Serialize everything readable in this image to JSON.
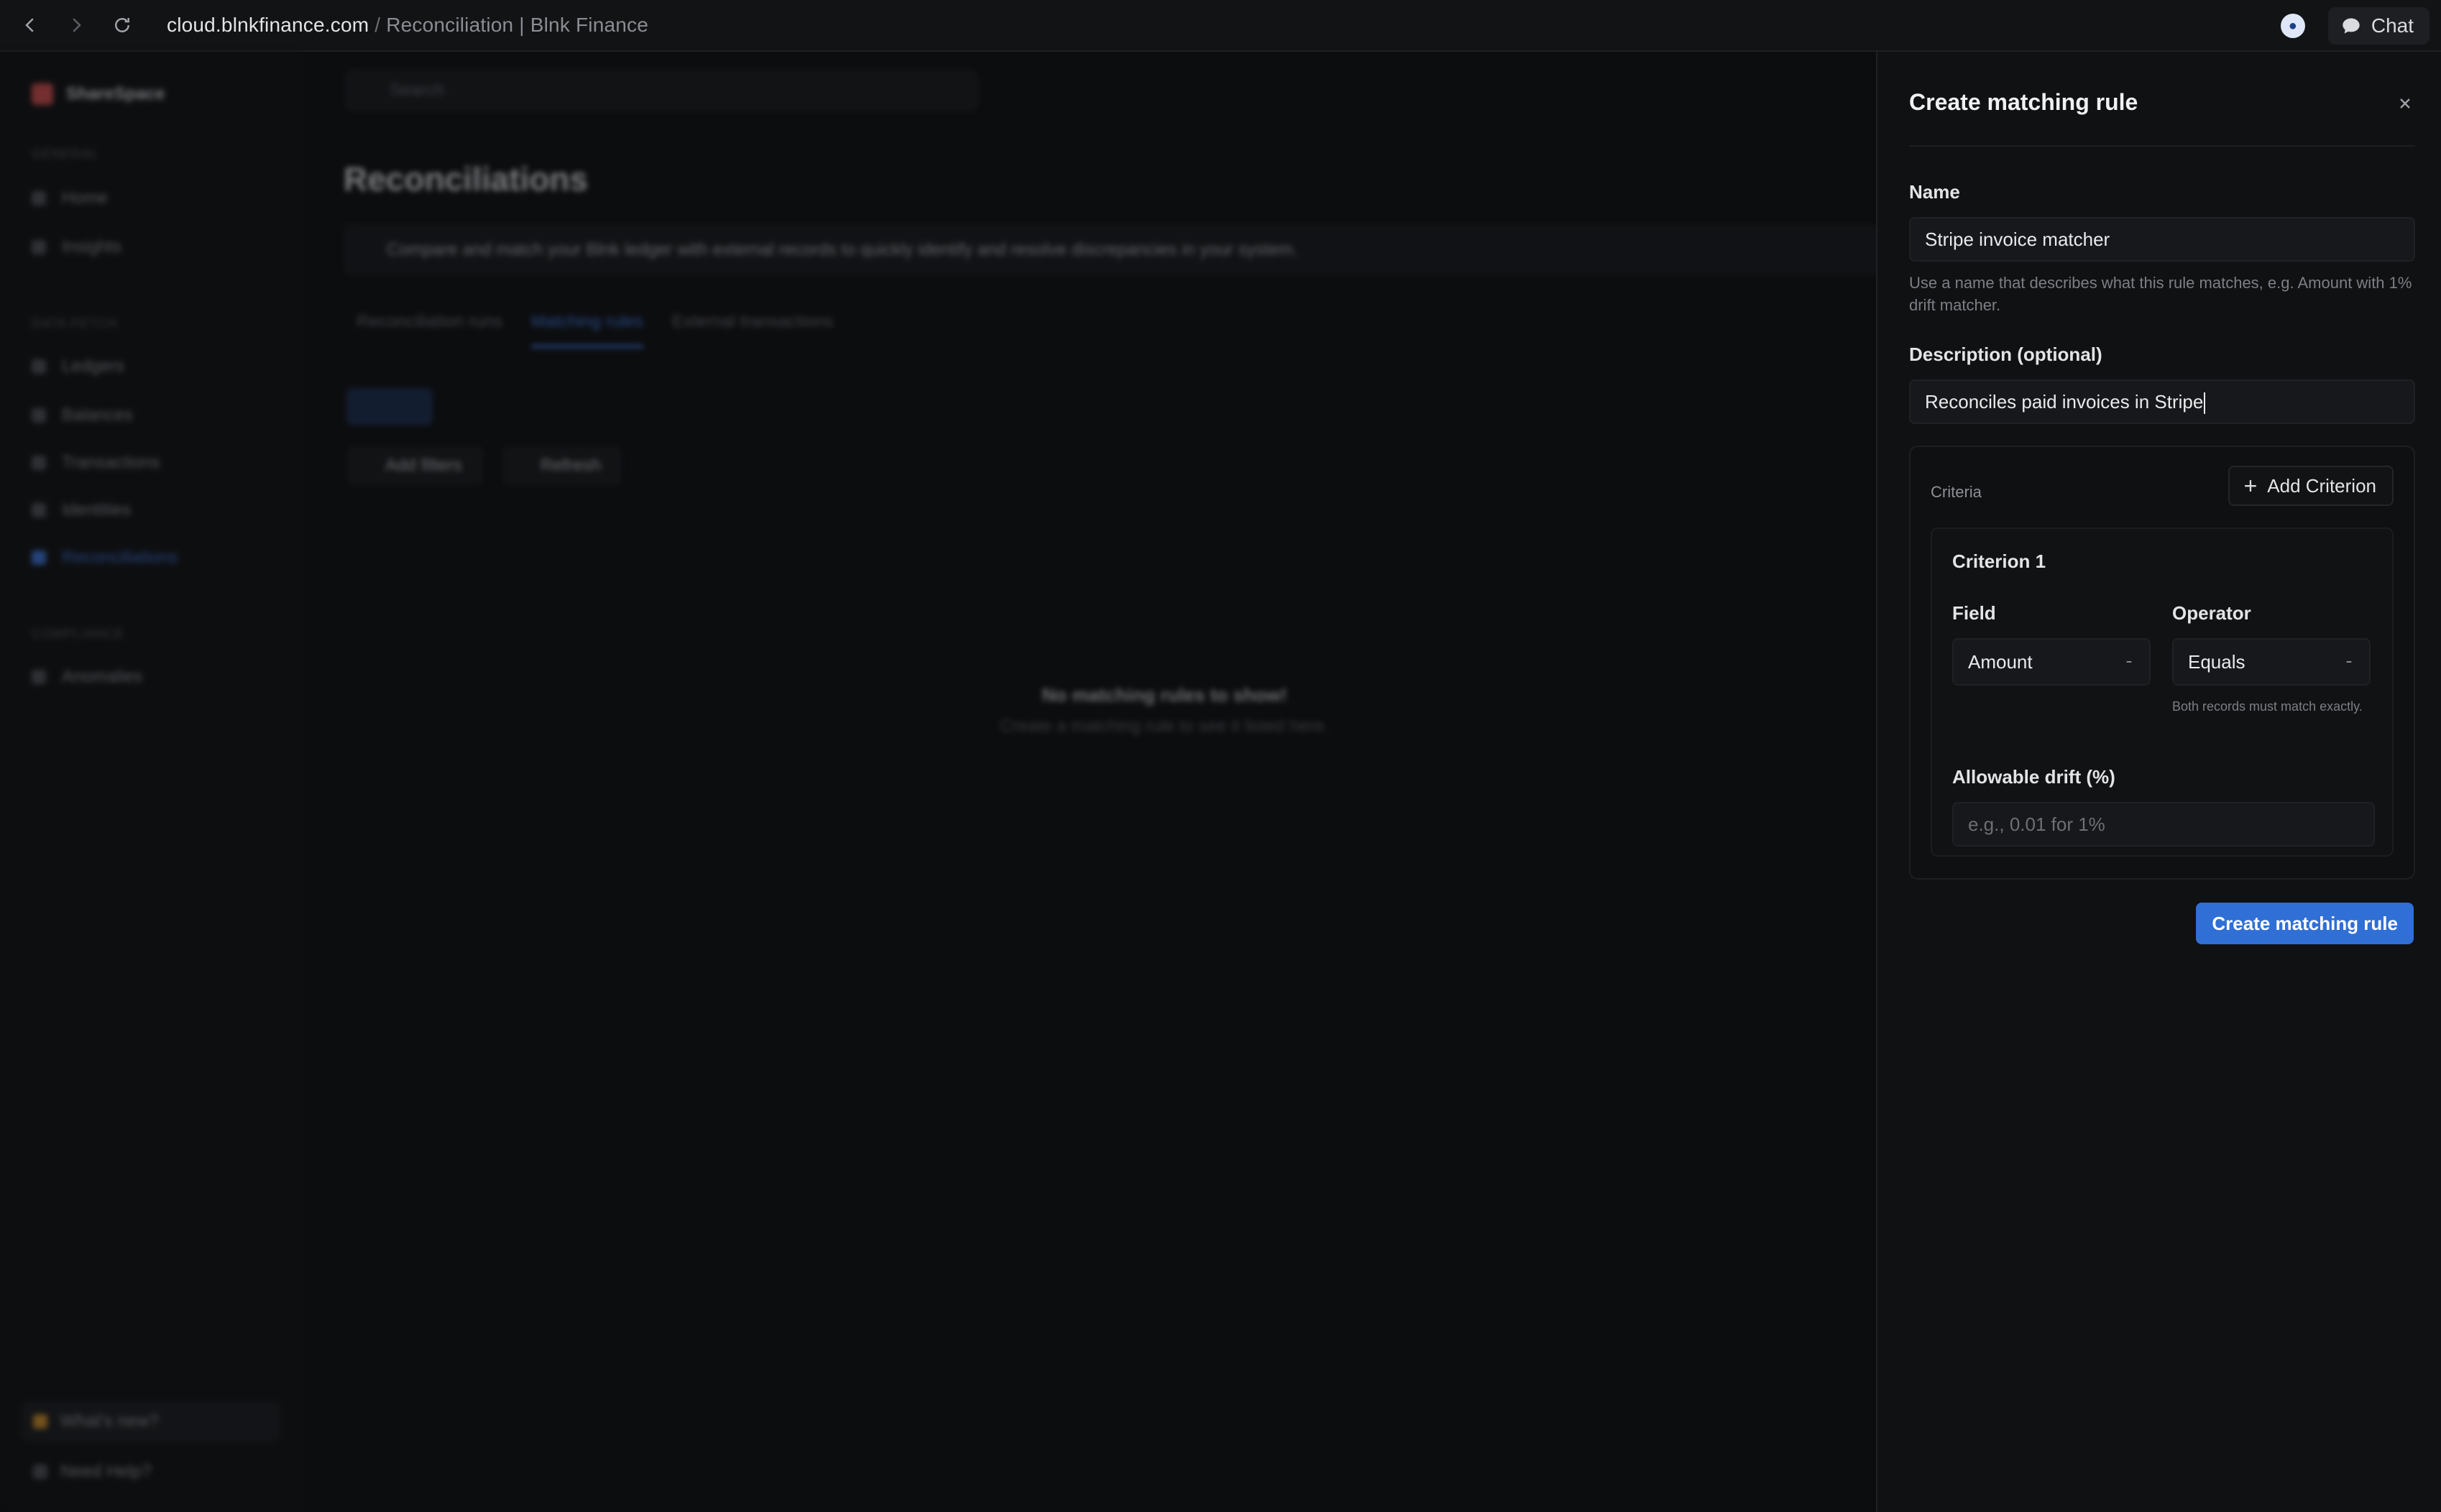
{
  "browser": {
    "url_host": "cloud.blnkfinance.com",
    "url_separator": " / ",
    "page_title": "Reconciliation | Blnk Finance",
    "chat_label": "Chat"
  },
  "background_app": {
    "workspace": "ShareSpace",
    "sections": [
      "GENERAL",
      "DATA FETCH",
      "COMPLIANCE"
    ],
    "sidebar_items": [
      "Home",
      "Insights",
      "Ledgers",
      "Balances",
      "Transactions",
      "Identities",
      "Reconciliations",
      "Anomalies"
    ],
    "sidebar_bottom": [
      "What's new?",
      "Need Help?"
    ],
    "search_placeholder": "Search",
    "page_heading": "Reconciliations",
    "banner_text": "Compare and match your Blnk ledger with external records to quickly identify and resolve discrepancies in your system.",
    "tabs": [
      "Reconciliation runs",
      "Matching rules",
      "External transactions"
    ],
    "buttons": [
      "Add filters",
      "Refresh"
    ],
    "empty_title": "No matching rules to show!",
    "empty_subtitle": "Create a matching rule to see it listed here."
  },
  "drawer": {
    "title": "Create matching rule",
    "name_label": "Name",
    "name_value": "Stripe invoice matcher",
    "name_help": "Use a name that describes what this rule matches, e.g. Amount with 1% drift matcher.",
    "description_label": "Description (optional)",
    "description_value": "Reconciles paid invoices in Stripe",
    "criteria_label": "Criteria",
    "add_criterion_label": "Add Criterion",
    "criterion": {
      "title": "Criterion 1",
      "field_label": "Field",
      "field_value": "Amount",
      "operator_label": "Operator",
      "operator_value": "Equals",
      "operator_help": "Both records must match exactly.",
      "drift_label": "Allowable drift (%)",
      "drift_placeholder": "e.g., 0.01 for 1%"
    },
    "submit_label": "Create matching rule"
  },
  "colors": {
    "accent": "#2f6fd6",
    "background": "#0c0d0f",
    "panel": "#101113"
  }
}
